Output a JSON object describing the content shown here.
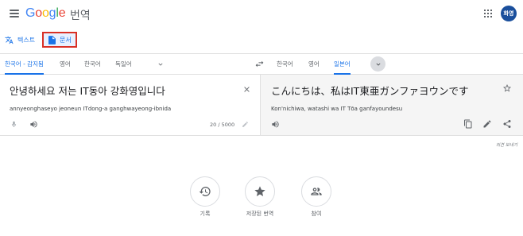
{
  "header": {
    "logo": {
      "G": "G",
      "o1": "o",
      "o2": "o",
      "g": "g",
      "l": "l",
      "e": "e"
    },
    "product": "번역",
    "avatar_text": "화영"
  },
  "modes": {
    "text_label": "텍스트",
    "documents_label": "문서"
  },
  "source_langs": [
    "한국어 - 감지됨",
    "영어",
    "한국어",
    "독일어"
  ],
  "target_langs": [
    "한국어",
    "영어",
    "일본어"
  ],
  "source": {
    "text": "안녕하세요 저는 IT동아 강화영입니다",
    "romanization": "annyeonghaseyo jeoneun ITdong-a ganghwayeong-ibnida",
    "char_count": "20 / 5000"
  },
  "target": {
    "text": "こんにちは、私はIT東亜ガンファヨウンです",
    "romanization": "Kon'nichiwa, watashi wa IT Tōa ganfayoundesu"
  },
  "feedback": "의견 보내기",
  "quick_actions": {
    "history": "기록",
    "saved": "저장된 번역",
    "community": "참여"
  },
  "colors": {
    "accent": "#1a73e8",
    "highlight_border": "#d93025",
    "avatar_bg": "#1a4f9c"
  }
}
